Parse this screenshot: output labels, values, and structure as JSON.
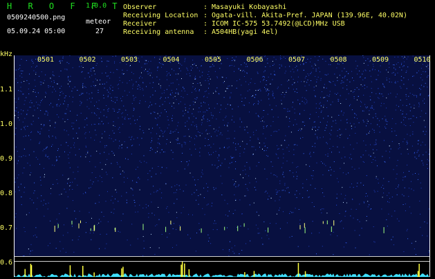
{
  "app": {
    "title": "H R O F F T",
    "version": "1.0.0"
  },
  "file": {
    "name": "0509240500.png",
    "timestamp": "05.09.24 05:00"
  },
  "meteor": {
    "label": "meteor",
    "count": "27"
  },
  "info": [
    {
      "key": "Observer",
      "value": "Masayuki Kobayashi"
    },
    {
      "key": "Receiving Location",
      "value": "Ogata-vill. Akita-Pref. JAPAN (139.96E, 40.02N)"
    },
    {
      "key": "Receiver",
      "value": "ICOM IC-575 53.7492(@LCD)MHz USB"
    },
    {
      "key": "Receiving antenna",
      "value": "A504HB(yagi 4el)"
    }
  ],
  "axis": {
    "unit": "kHz",
    "y_ticks": [
      "1.1",
      "1.0",
      "0.9",
      "0.8",
      "0.7",
      "0.6"
    ],
    "x_ticks": [
      "0501",
      "0502",
      "0503",
      "0504",
      "0505",
      "0506",
      "0507",
      "0508",
      "0509",
      "0510"
    ]
  },
  "colors": {
    "accent": "#20e020",
    "label": "#ffff66",
    "background": "#000000",
    "spectrum": "#081040"
  }
}
